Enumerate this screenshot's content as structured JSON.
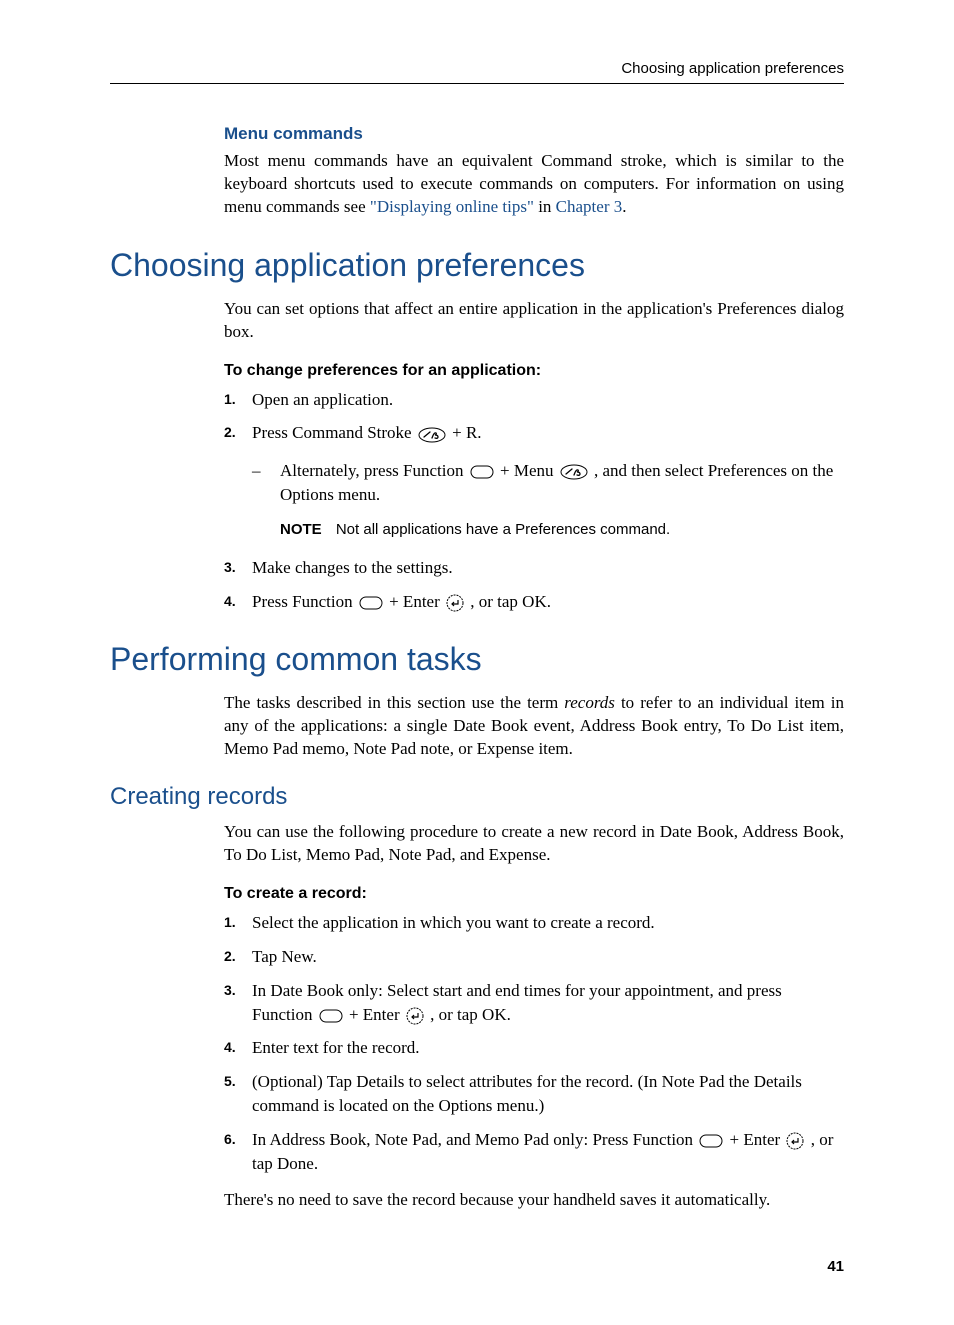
{
  "running_head": "Choosing application preferences",
  "page_number": "41",
  "sec1": {
    "heading": "Menu commands",
    "para_pre": "Most menu commands have an equivalent Command stroke, which is similar to the keyboard shortcuts used to execute commands on computers. For information on using menu commands see ",
    "link1": "\"Displaying online tips\"",
    "para_mid": " in ",
    "link2": "Chapter 3",
    "para_end": "."
  },
  "sec2": {
    "h1": "Choosing application preferences",
    "intro": "You can set options that affect an entire application in the application's Preferences dialog box.",
    "proc_title": "To change preferences for an application:",
    "steps": {
      "s1": "Open an application.",
      "s2_pre": "Press Command Stroke ",
      "s2_post": " + R.",
      "s2sub_pre": "Alternately, press Function ",
      "s2sub_mid": " + Menu ",
      "s2sub_post": ", and then select Preferences on the Options menu.",
      "note_label": "NOTE",
      "note_text": "Not all applications have a Preferences command.",
      "s3": "Make changes to the settings.",
      "s4_pre": "Press Function ",
      "s4_mid": " + Enter ",
      "s4_post": ", or tap OK."
    }
  },
  "sec3": {
    "h1": "Performing common tasks",
    "intro_pre": "The tasks described in this section use the term ",
    "intro_em": "records",
    "intro_post": " to refer to an individual item in any of the applications: a single Date Book event, Address Book entry, To Do List item, Memo Pad memo, Note Pad note, or Expense item.",
    "h2": "Creating records",
    "intro2": "You can use the following procedure to create a new record in Date Book, Address Book, To Do List, Memo Pad, Note Pad, and Expense.",
    "proc_title": "To create a record:",
    "steps": {
      "s1": "Select the application in which you want to create a record.",
      "s2": "Tap New.",
      "s3_pre": "In Date Book only: Select start and end times for your appointment, and press Function ",
      "s3_mid": " + Enter ",
      "s3_post": ", or tap OK.",
      "s4": "Enter text for the record.",
      "s5": "(Optional) Tap Details to select attributes for the record. (In Note Pad the Details command is located on the Options menu.)",
      "s6_pre": "In Address Book, Note Pad, and Memo Pad only: Press Function ",
      "s6_mid": " + Enter ",
      "s6_post": ", or tap Done."
    },
    "closing": "There's no need to save the record because your handheld saves it automatically."
  }
}
